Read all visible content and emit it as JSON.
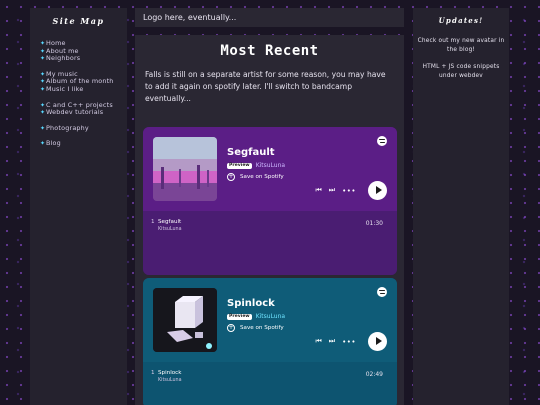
{
  "sidebar": {
    "title": "Site Map",
    "groups": [
      {
        "items": [
          {
            "label": "Home"
          },
          {
            "label": "About me"
          },
          {
            "label": "Neighbors"
          }
        ]
      },
      {
        "items": [
          {
            "label": "My music"
          },
          {
            "label": "Album of the month"
          },
          {
            "label": "Music I like"
          }
        ]
      },
      {
        "items": [
          {
            "label": "C and C++ projects"
          },
          {
            "label": "Webdev tutorials"
          }
        ]
      },
      {
        "items": [
          {
            "label": "Photography"
          }
        ]
      },
      {
        "items": [
          {
            "label": "Blog"
          }
        ]
      }
    ]
  },
  "header": {
    "logo_text": "Logo here, eventually..."
  },
  "main": {
    "title": "Most Recent",
    "text": "Falls is still on a separate artist for some reason, you may have to add it again on spotify later. I'll switch to bandcamp eventually...",
    "embeds": [
      {
        "track_title": "Segfault",
        "badge": "Preview",
        "artist": "KitsuLuna",
        "save_label": "Save on Spotify",
        "tracklist": [
          {
            "num": "1",
            "name": "Segfault",
            "artist": "KitsuLuna",
            "duration": "01:30"
          }
        ],
        "color": "#5b1e86"
      },
      {
        "track_title": "Spinlock",
        "badge": "Preview",
        "artist": "KitsuLuna",
        "save_label": "Save on Spotify",
        "tracklist": [
          {
            "num": "1",
            "name": "Spinlock",
            "artist": "KitsuLuna",
            "duration": "02:49"
          }
        ],
        "color": "#0f5c78"
      }
    ],
    "icons": [
      "spotify-logo-icon",
      "plus-circle-icon",
      "previous-track-icon",
      "next-track-icon",
      "more-options-icon",
      "play-icon"
    ]
  },
  "updates": {
    "title": "Updates!",
    "lines": [
      "Check out my new avatar in the blog!",
      "HTML + JS code snippets under webdev"
    ]
  },
  "colors": {
    "accent_bullet": "#59d8ff",
    "background": "#1a1524",
    "panel": "#25222e"
  }
}
